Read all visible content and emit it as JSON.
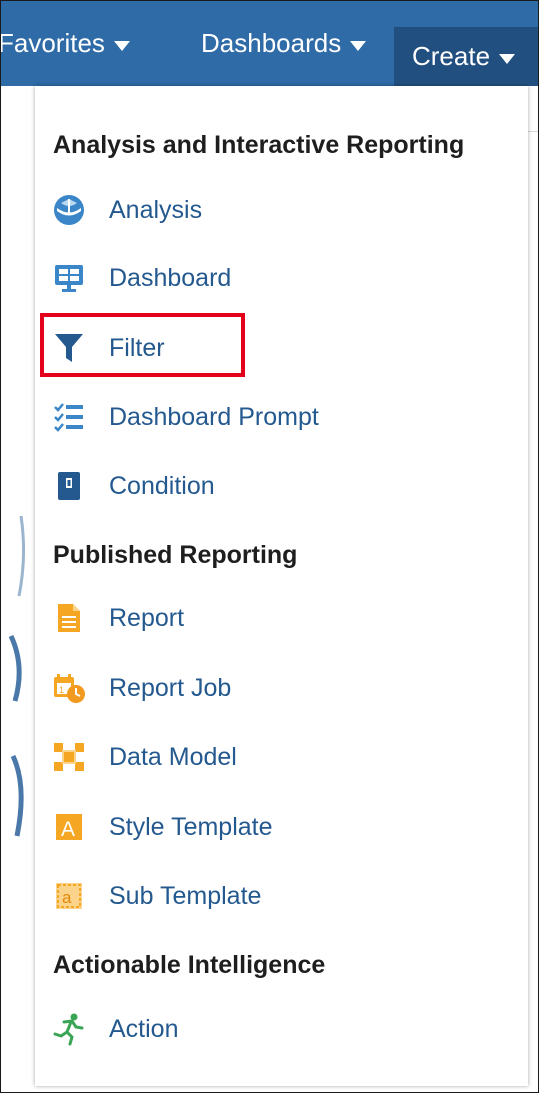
{
  "topbar": {
    "favorites_label": "Favorites",
    "dashboards_label": "Dashboards",
    "create_label": "Create"
  },
  "menu": {
    "sections": [
      {
        "heading": "Analysis and Interactive Reporting",
        "items": [
          {
            "label": "Analysis",
            "icon": "analysis-icon"
          },
          {
            "label": "Dashboard",
            "icon": "dashboard-icon"
          },
          {
            "label": "Filter",
            "icon": "filter-icon"
          },
          {
            "label": "Dashboard Prompt",
            "icon": "dashboard-prompt-icon"
          },
          {
            "label": "Condition",
            "icon": "condition-icon"
          }
        ]
      },
      {
        "heading": "Published Reporting",
        "items": [
          {
            "label": "Report",
            "icon": "report-icon"
          },
          {
            "label": "Report Job",
            "icon": "report-job-icon"
          },
          {
            "label": "Data Model",
            "icon": "data-model-icon"
          },
          {
            "label": "Style Template",
            "icon": "style-template-icon"
          },
          {
            "label": "Sub Template",
            "icon": "sub-template-icon"
          }
        ]
      },
      {
        "heading": "Actionable Intelligence",
        "items": [
          {
            "label": "Action",
            "icon": "action-icon"
          }
        ]
      }
    ]
  },
  "colors": {
    "topbar": "#2f6ba7",
    "create_active": "#214f80",
    "link_text": "#24598f",
    "highlight": "#e3001b",
    "bi_icon_blue": "#3a86c8",
    "publisher_icon_orange": "#f5a623",
    "action_icon_green": "#3aa655"
  }
}
